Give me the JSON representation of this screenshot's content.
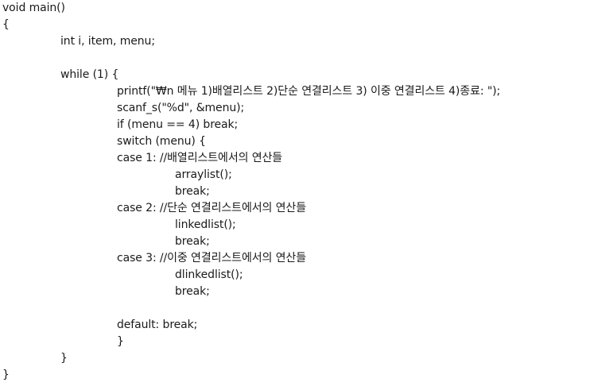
{
  "code": {
    "lines": [
      "void main()",
      "{",
      "int i, item, menu;",
      "",
      "while (1) {",
      "printf(\"₩n 메뉴 1)배열리스트 2)단순 연결리스트 3) 이중 연결리스트 4)종료: \");",
      "scanf_s(\"%d\", &menu);",
      "if (menu == 4) break;",
      "switch (menu) {",
      "case 1: //배열리스트에서의 연산들",
      "arraylist();",
      "break;",
      "case 2: //단순 연결리스트에서의 연산들",
      "linkedlist();",
      "break;",
      "case 3: //이중 연결리스트에서의 연산들",
      "dlinkedlist();",
      "break;",
      "",
      "default: break;",
      "}",
      "}",
      "}"
    ]
  }
}
